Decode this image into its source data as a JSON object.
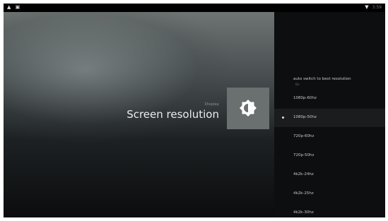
{
  "status_bar": {
    "left_icons": [
      "android-icon",
      "notification-icon"
    ],
    "wifi_icon": "wifi-icon",
    "time": "3:59"
  },
  "header": {
    "breadcrumb": "Display",
    "title": "Screen resolution",
    "icon": "brightness-icon"
  },
  "options": [
    {
      "label": "auto switch to best resolution",
      "sub": "On",
      "selected": false
    },
    {
      "label": "1080p-60hz",
      "selected": false
    },
    {
      "label": "1080p-50hz",
      "selected": true
    },
    {
      "label": "720p-60hz",
      "selected": false
    },
    {
      "label": "720p-50hz",
      "selected": false
    },
    {
      "label": "4k2k-24hz",
      "selected": false
    },
    {
      "label": "4k2k-25hz",
      "selected": false
    },
    {
      "label": "4k2k-30hz",
      "selected": false
    }
  ],
  "colors": {
    "background": "#0c0c0d",
    "panel": "#0d0e0f",
    "selected_row": "#1b1c1d",
    "icon_tile": "#6a6f70",
    "text": "#c8caca"
  }
}
